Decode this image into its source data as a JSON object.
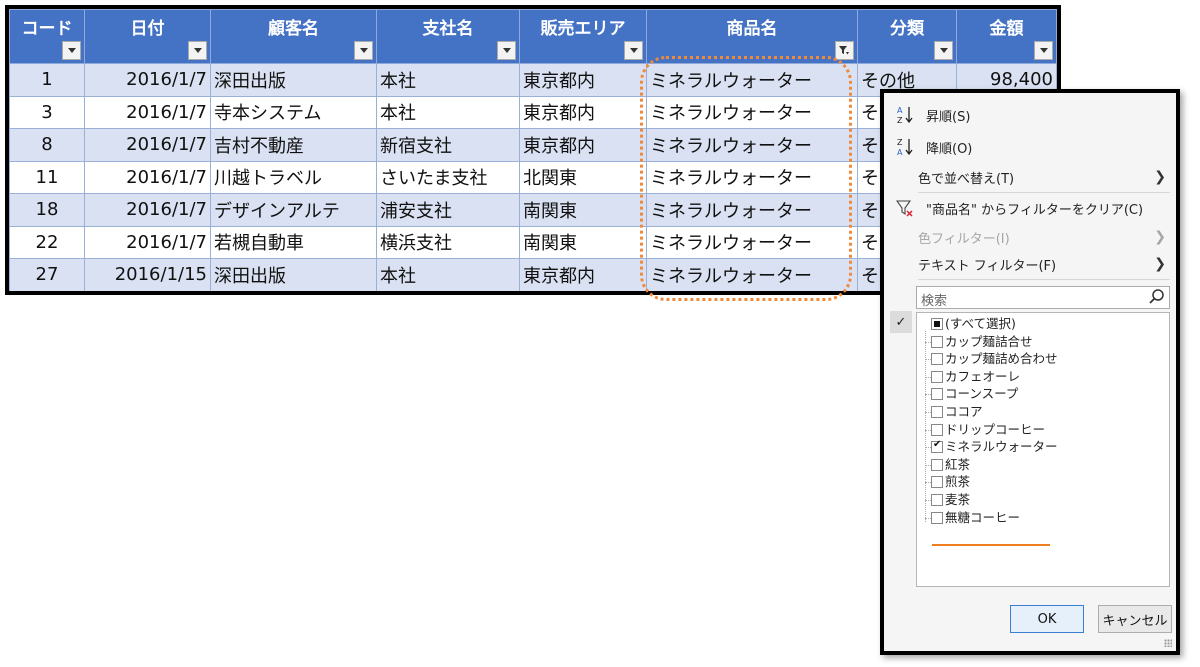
{
  "table": {
    "headers": [
      "コード",
      "日付",
      "顧客名",
      "支社名",
      "販売エリア",
      "商品名",
      "分類",
      "金額"
    ],
    "rows": [
      {
        "code": "1",
        "date": "2016/1/7",
        "customer": "深田出版",
        "branch": "本社",
        "area": "東京都内",
        "product": "ミネラルウォーター",
        "category": "その他",
        "amount": "98,400"
      },
      {
        "code": "3",
        "date": "2016/1/7",
        "customer": "寺本システム",
        "branch": "本社",
        "area": "東京都内",
        "product": "ミネラルウォーター",
        "category": "そ",
        "amount": ""
      },
      {
        "code": "8",
        "date": "2016/1/7",
        "customer": "吉村不動産",
        "branch": "新宿支社",
        "area": "東京都内",
        "product": "ミネラルウォーター",
        "category": "そ",
        "amount": ""
      },
      {
        "code": "11",
        "date": "2016/1/7",
        "customer": "川越トラベル",
        "branch": "さいたま支社",
        "area": "北関東",
        "product": "ミネラルウォーター",
        "category": "そ",
        "amount": ""
      },
      {
        "code": "18",
        "date": "2016/1/7",
        "customer": "デザインアルテ",
        "branch": "浦安支社",
        "area": "南関東",
        "product": "ミネラルウォーター",
        "category": "そ",
        "amount": ""
      },
      {
        "code": "22",
        "date": "2016/1/7",
        "customer": "若槻自動車",
        "branch": "横浜支社",
        "area": "南関東",
        "product": "ミネラルウォーター",
        "category": "そ",
        "amount": ""
      },
      {
        "code": "27",
        "date": "2016/1/15",
        "customer": "深田出版",
        "branch": "本社",
        "area": "東京都内",
        "product": "ミネラルウォーター",
        "category": "そ",
        "amount": ""
      }
    ],
    "filtered_column": "商品名"
  },
  "filter_menu": {
    "sort_asc": "昇順(S)",
    "sort_desc": "降順(O)",
    "sort_by_color": "色で並べ替え(T)",
    "clear_filter": "\"商品名\" からフィルターをクリア(C)",
    "color_filter": "色フィルター(I)",
    "text_filter": "テキスト フィルター(F)",
    "search_placeholder": "検索",
    "items": [
      {
        "label": "(すべて選択)",
        "state": "partial"
      },
      {
        "label": "カップ麺詰合せ",
        "state": "off"
      },
      {
        "label": "カップ麺詰め合わせ",
        "state": "off"
      },
      {
        "label": "カフェオーレ",
        "state": "off"
      },
      {
        "label": "コーンスープ",
        "state": "off"
      },
      {
        "label": "ココア",
        "state": "off"
      },
      {
        "label": "ドリップコーヒー",
        "state": "off"
      },
      {
        "label": "ミネラルウォーター",
        "state": "on"
      },
      {
        "label": "紅茶",
        "state": "off"
      },
      {
        "label": "煎茶",
        "state": "off"
      },
      {
        "label": "麦茶",
        "state": "off"
      },
      {
        "label": "無糖コーヒー",
        "state": "off"
      }
    ],
    "ok_label": "OK",
    "cancel_label": "キャンセル",
    "side_check": "✓"
  },
  "colors": {
    "header_bg": "#4472c4",
    "band_bg": "#d9e1f2",
    "highlight": "#ef8a3c"
  }
}
